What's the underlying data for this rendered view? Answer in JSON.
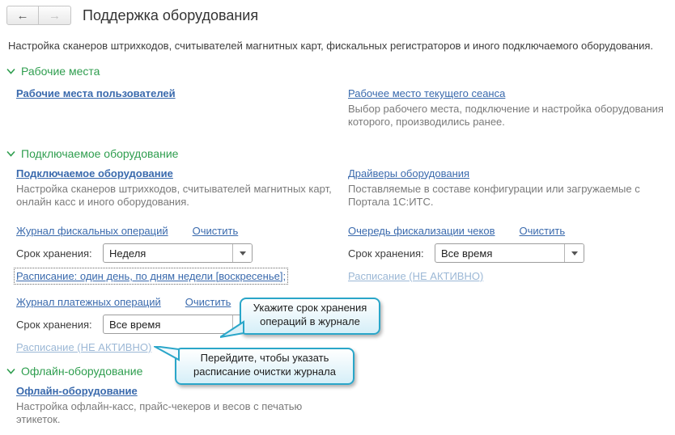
{
  "window": {
    "title": "Поддержка оборудования"
  },
  "nav": {
    "back_icon": "←",
    "forward_icon": "→"
  },
  "intro": "Настройка сканеров штрихкодов, считывателей магнитных карт, фискальных регистраторов и иного подключаемого оборудования.",
  "sections": {
    "workplaces": {
      "title": "Рабочие места",
      "users_link": "Рабочие места пользователей",
      "current_link": "Рабочее место текущего сеанса",
      "current_desc": "Выбор рабочего места, подключение и настройка оборудования которого, производились ранее."
    },
    "connected": {
      "title": "Подключаемое оборудование",
      "main_link": "Подключаемое оборудование",
      "main_desc": "Настройка сканеров штрихкодов, считывателей магнитных карт, онлайн касс и иного оборудования.",
      "drivers_link": "Драйверы оборудования",
      "drivers_desc": "Поставляемые в составе конфигурации или загружаемые с Портала 1С:ИТС.",
      "fiscal_journal": {
        "link": "Журнал фискальных операций",
        "clear_link": "Очистить",
        "retention_label": "Срок хранения:",
        "retention_value": "Неделя",
        "schedule_link": "Расписание: один день, по дням недели [воскресенье];"
      },
      "fiscal_queue": {
        "link": "Очередь фискализации чеков",
        "clear_link": "Очистить",
        "retention_label": "Срок хранения:",
        "retention_value": "Все время",
        "schedule_link": "Расписание (НЕ АКТИВНО)"
      },
      "payment_journal": {
        "link": "Журнал платежных операций",
        "clear_link": "Очистить",
        "retention_label": "Срок хранения:",
        "retention_value": "Все время",
        "schedule_link": "Расписание (НЕ АКТИВНО)"
      }
    },
    "offline": {
      "title": "Офлайн-оборудование",
      "main_link": "Офлайн-оборудование",
      "main_desc": "Настройка офлайн-касс, прайс-чекеров и весов с печатью этикеток."
    }
  },
  "tooltips": {
    "retention_hint": "Укажите срок хранения операций в журнале",
    "schedule_hint": "Перейдите, чтобы указать расписание очистки журнала"
  },
  "colors": {
    "section_green": "#2f9e4f",
    "link_blue": "#3a6aad",
    "disabled_link": "#9cb8d6",
    "tooltip_border": "#2aa6c9"
  }
}
